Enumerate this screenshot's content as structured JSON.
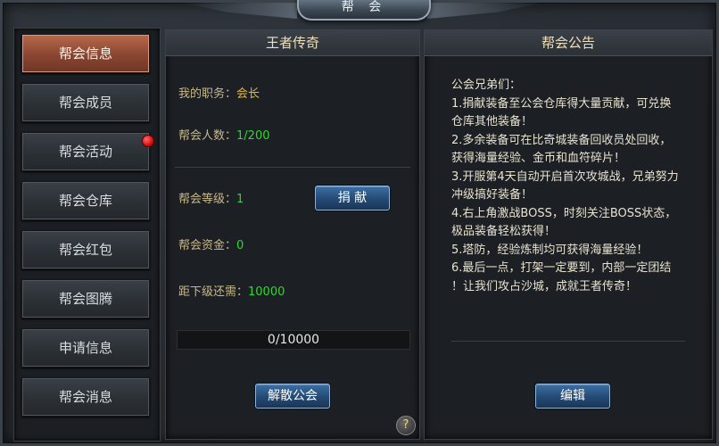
{
  "window": {
    "title": "帮 会"
  },
  "sidebar": {
    "items": [
      {
        "label": "帮会信息",
        "active": true
      },
      {
        "label": "帮会成员"
      },
      {
        "label": "帮会活动",
        "notification": true
      },
      {
        "label": "帮会仓库"
      },
      {
        "label": "帮会红包"
      },
      {
        "label": "帮会图腾"
      },
      {
        "label": "申请信息"
      },
      {
        "label": "帮会消息"
      }
    ]
  },
  "info": {
    "guild_name": "王者传奇",
    "position_label": "我的职务：",
    "position_value": "会长",
    "members_label": "帮会人数：",
    "members_value": "1/200",
    "level_label": "帮会等级：",
    "level_value": "1",
    "donate_button": "捐 献",
    "funds_label": "帮会资金：",
    "funds_value": "0",
    "next_label": "距下级还需：",
    "next_value": "10000",
    "progress": {
      "text": "0/10000",
      "current": 0,
      "max": 10000
    },
    "disband_button": "解散公会",
    "help": "?"
  },
  "notice": {
    "title": "帮会公告",
    "lines": [
      "公会兄弟们：",
      "1.捐献装备至公会仓库得大量贡献，可兑换",
      "仓库其他装备！",
      "2.多余装备可在比奇城装备回收员处回收，",
      "获得海量经验、金币和血符碎片！",
      "3.开服第4天自动开启首次攻城战，兄弟努力",
      "冲级搞好装备！",
      "4.右上角激战BOSS，时刻关注BOSS状态，",
      "极品装备轻松获得！",
      "5.塔防，经验炼制均可获得海量经验！",
      "6.最后一点，打架一定要到，内部一定团结",
      "！让我们攻占沙城，成就王者传奇！"
    ],
    "edit_button": "编辑"
  },
  "colors": {
    "active_tab": "#8a4632",
    "accent_gold": "#e0b84a",
    "accent_green": "#2fd82f",
    "button_blue": "#244a74"
  }
}
